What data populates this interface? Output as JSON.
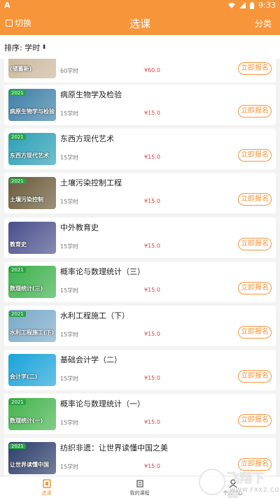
{
  "status_bar": {
    "app_icon": "A",
    "time": "9:33"
  },
  "nav": {
    "switch_label": "切换",
    "title": "选课",
    "category_label": "分类"
  },
  "sort": {
    "label": "排序: 学时"
  },
  "courses": [
    {
      "thumb_caption": "(储蓄新)",
      "year": "",
      "name": "",
      "hours": "60学时",
      "price": "¥60.0",
      "button": "立即报名",
      "thumb_color": "#c9b79a"
    },
    {
      "thumb_caption": "病原生物学与检验",
      "year": "2021",
      "name": "病原生物学及检验",
      "hours": "15学时",
      "price": "¥15.0",
      "button": "立即报名",
      "thumb_color": "#3d7fa7"
    },
    {
      "thumb_caption": "东西方现代艺术",
      "year": "2021",
      "name": "东西方现代艺术",
      "hours": "15学时",
      "price": "¥15.0",
      "button": "立即报名",
      "thumb_color": "#2a9fb5"
    },
    {
      "thumb_caption": "土壤污染控制",
      "year": "2021",
      "name": "土壤污染控制工程",
      "hours": "15学时",
      "price": "¥15.0",
      "button": "立即报名",
      "thumb_color": "#6b5a3a"
    },
    {
      "thumb_caption": "教育史",
      "year": "",
      "name": "中外教育史",
      "hours": "15学时",
      "price": "¥15.0",
      "button": "立即报名",
      "thumb_color": "#4a4f8c"
    },
    {
      "thumb_caption": "数理统计(三)",
      "year": "2021",
      "name": "概率论与数理统计（三）",
      "hours": "15学时",
      "price": "¥15.0",
      "button": "立即报名",
      "thumb_color": "#3bb04a"
    },
    {
      "thumb_caption": "水利工程施工(下)",
      "year": "2021",
      "name": "水利工程施工（下）",
      "hours": "15学时",
      "price": "¥15.0",
      "button": "立即报名",
      "thumb_color": "#7aa9c8"
    },
    {
      "thumb_caption": "会计学(二)",
      "year": "",
      "name": "基础会计学（二）",
      "hours": "15学时",
      "price": "¥15.0",
      "button": "立即报名",
      "thumb_color": "#1aa3d8"
    },
    {
      "thumb_caption": "数理统计(一)",
      "year": "2021",
      "name": "概率论与数理统计（一）",
      "hours": "15学时",
      "price": "¥15.0",
      "button": "立即报名",
      "thumb_color": "#43b34c"
    },
    {
      "thumb_caption": "让世界读懂中国",
      "year": "2021",
      "name": "纺织非遗：让世界读懂中国之美",
      "hours": "15学时",
      "price": "¥15.0",
      "button": "立即报名",
      "thumb_color": "#2c3e6b"
    }
  ],
  "tabs": [
    {
      "label": "选课",
      "icon": "course-select-icon",
      "active": true
    },
    {
      "label": "我的课程",
      "icon": "my-courses-icon",
      "active": false
    },
    {
      "label": "个人中心",
      "icon": "profile-icon",
      "active": false
    }
  ],
  "watermark": {
    "text": "飞翔下载",
    "url": "WWW.FXXZ.COM"
  },
  "colors": {
    "accent": "#f7953a",
    "price": "#e54040"
  }
}
